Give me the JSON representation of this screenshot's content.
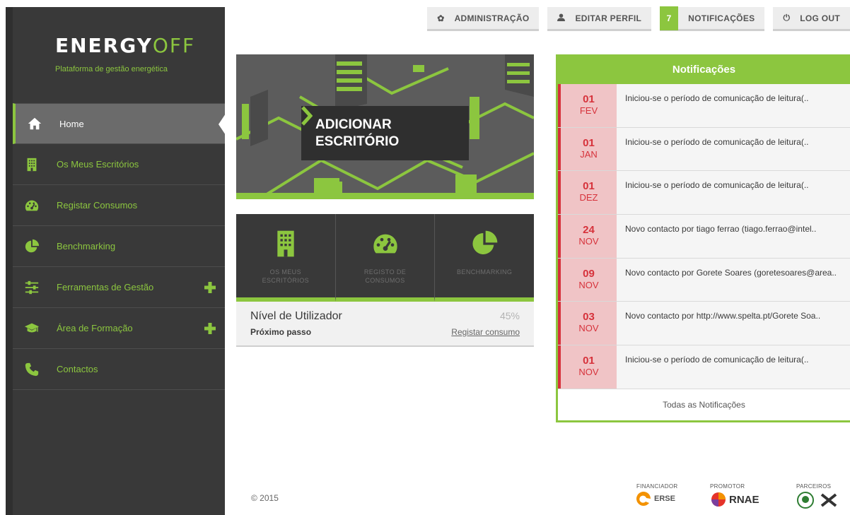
{
  "app": {
    "logo_main": "ENERGY",
    "logo_accent": "OFF",
    "tagline": "Plataforma de gestão energética"
  },
  "topbar": {
    "admin_label": "ADMINISTRAÇÃO",
    "profile_label": "EDITAR PERFIL",
    "notifications_count": "7",
    "notifications_label": "NOTIFICAÇÕES",
    "logout_label": "LOG OUT"
  },
  "sidebar": {
    "items": [
      {
        "label": "Home",
        "icon": "home-icon",
        "active": true
      },
      {
        "label": "Os Meus Escritórios",
        "icon": "building-icon"
      },
      {
        "label": "Registar Consumos",
        "icon": "gauge-icon"
      },
      {
        "label": "Benchmarking",
        "icon": "pie-chart-icon"
      },
      {
        "label": "Ferramentas de Gestão",
        "icon": "sliders-icon",
        "expandable": true
      },
      {
        "label": "Área de Formação",
        "icon": "graduation-cap-icon",
        "expandable": true
      },
      {
        "label": "Contactos",
        "icon": "phone-icon"
      }
    ]
  },
  "hero": {
    "cta_line1": "ADICIONAR",
    "cta_line2": "ESCRITÓRIO"
  },
  "tiles": [
    {
      "label_1": "OS MEUS",
      "label_2": "ESCRITÓRIOS",
      "icon": "building-icon"
    },
    {
      "label_1": "REGISTO DE",
      "label_2": "CONSUMOS",
      "icon": "gauge-icon"
    },
    {
      "label_1": "BENCHMARKING",
      "label_2": "",
      "icon": "pie-chart-icon"
    }
  ],
  "user_level": {
    "title": "Nível de Utilizador",
    "percent": "45%",
    "next_label": "Próximo passo",
    "next_link": "Registar consumo"
  },
  "notifications": {
    "title": "Notificações",
    "items": [
      {
        "day": "01",
        "month": "FEV",
        "text": "Iniciou-se o período de comunicação de leitura(.."
      },
      {
        "day": "01",
        "month": "JAN",
        "text": "Iniciou-se o período de comunicação de leitura(.."
      },
      {
        "day": "01",
        "month": "DEZ",
        "text": "Iniciou-se o período de comunicação de leitura(.."
      },
      {
        "day": "24",
        "month": "NOV",
        "text": "Novo contacto por tiago ferrao (tiago.ferrao@intel.."
      },
      {
        "day": "09",
        "month": "NOV",
        "text": "Novo contacto por Gorete Soares (goretesoares@area.."
      },
      {
        "day": "03",
        "month": "NOV",
        "text": "Novo contacto por http://www.spelta.pt/Gorete Soa.."
      },
      {
        "day": "01",
        "month": "NOV",
        "text": "Iniciou-se o período de comunicação de leitura(.."
      }
    ],
    "all_label": "Todas as Notificações"
  },
  "footer": {
    "copyright": "© 2015",
    "financiador": "FINANCIADOR",
    "promotor": "PROMOTOR",
    "parceiros": "PARCEIROS",
    "financiador_logo": "ERSE",
    "promotor_logo": "RNAE"
  },
  "colors": {
    "accent": "#8cc63f",
    "sidebar_bg": "#393939",
    "alert_red": "#d6323b",
    "alert_bg": "#f0c4c6"
  }
}
